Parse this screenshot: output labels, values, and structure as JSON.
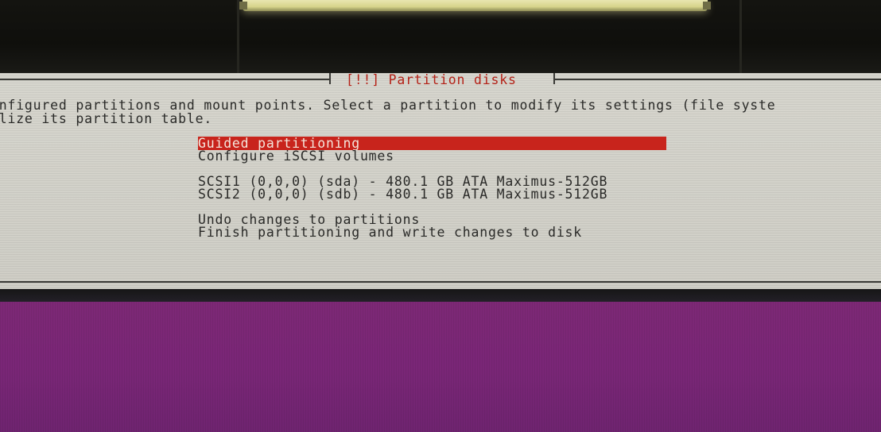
{
  "dialog": {
    "title": "[!!] Partition disks",
    "description_line1": "onfigured partitions and mount points. Select a partition to modify its settings (file syste",
    "description_line2": "alize its partition table."
  },
  "menu": {
    "selected_index": 0,
    "items": [
      "Guided partitioning",
      "Configure iSCSI volumes",
      "SCSI1 (0,0,0) (sda) - 480.1 GB ATA Maximus-512GB",
      "SCSI2 (0,0,0) (sdb) - 480.1 GB ATA Maximus-512GB",
      "Undo changes to partitions",
      "Finish partitioning and write changes to disk"
    ]
  },
  "colors": {
    "dialog_background": "#d5d4cc",
    "title_text": "#b42218",
    "selection_highlight": "#c8241c",
    "desktop_background": "#7b2776"
  }
}
